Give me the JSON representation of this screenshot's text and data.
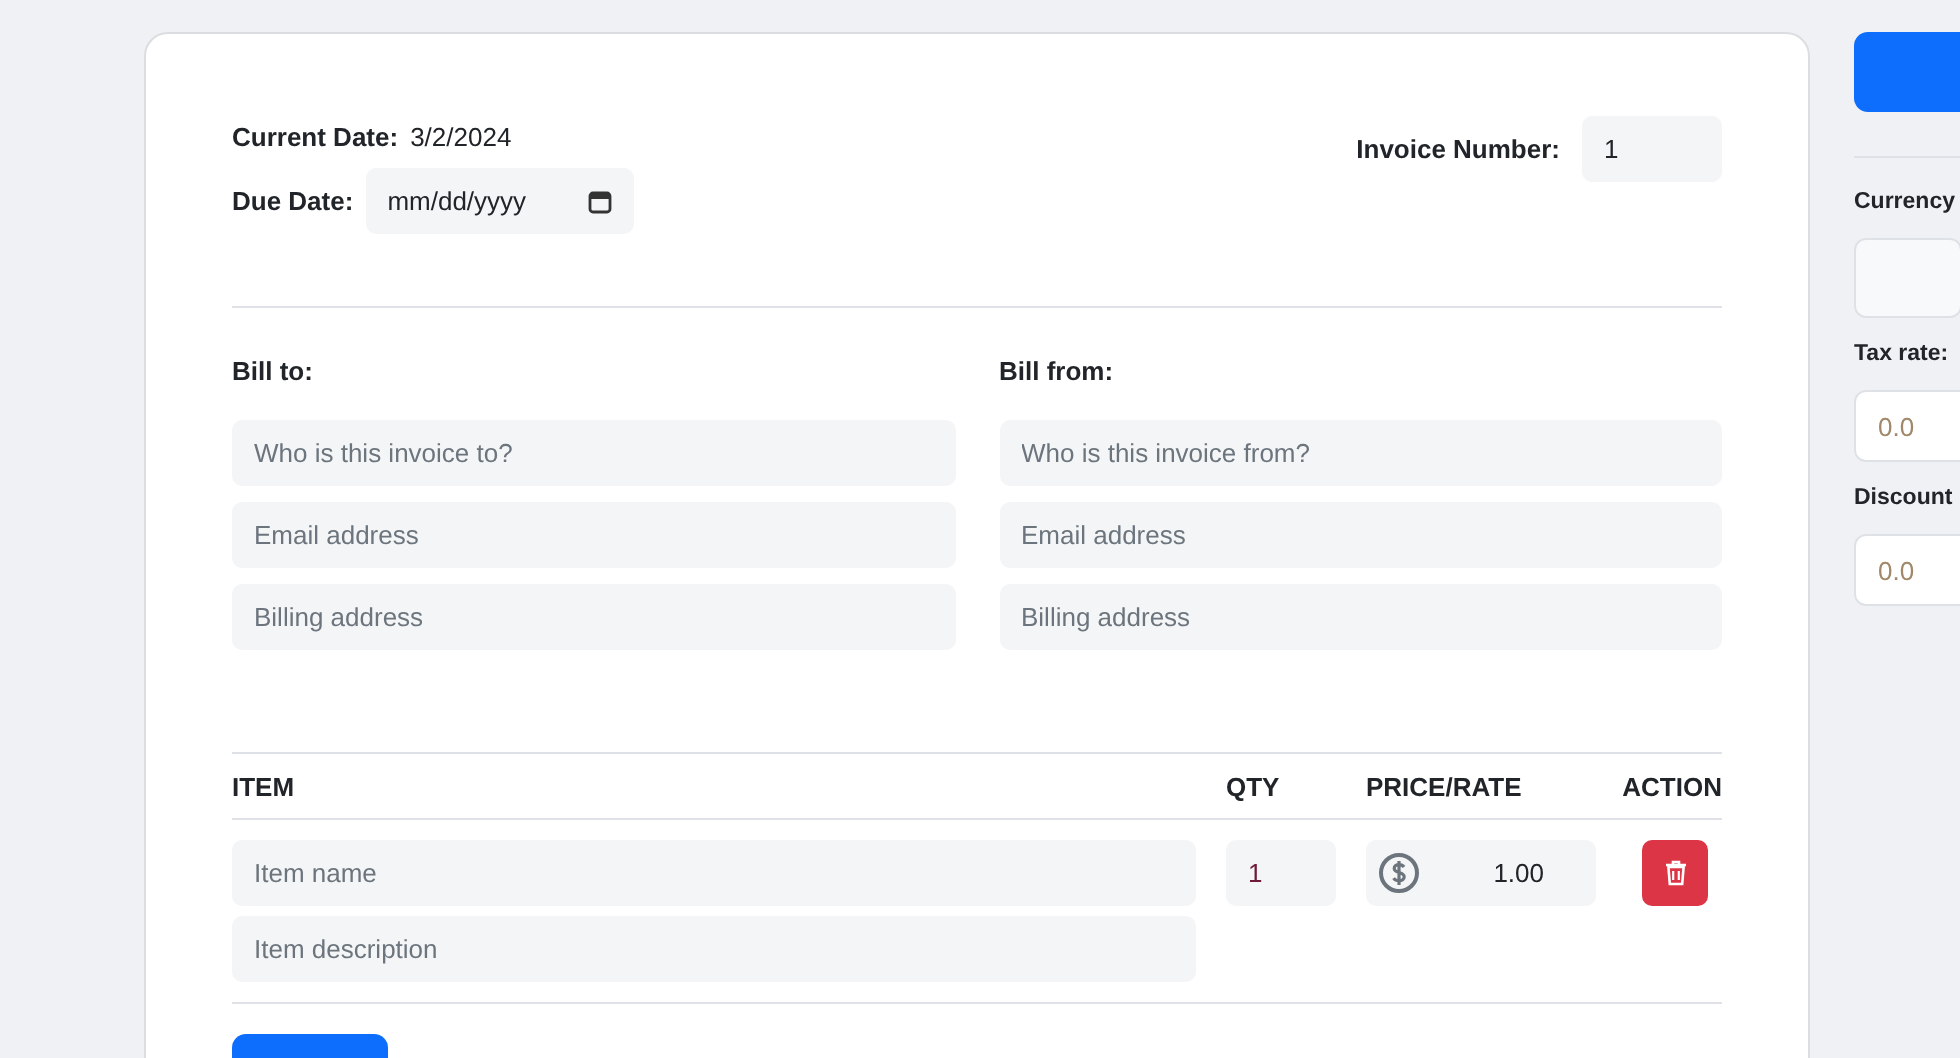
{
  "header": {
    "current_date_label": "Current Date:",
    "current_date": "3/2/2024",
    "due_date_label": "Due Date:",
    "due_date_placeholder": "mm/dd/yyyy",
    "invoice_number_label": "Invoice Number:",
    "invoice_number": "1"
  },
  "bill_to": {
    "label": "Bill to:",
    "fields": [
      {
        "placeholder": "Who is this invoice to?"
      },
      {
        "placeholder": "Email address"
      },
      {
        "placeholder": "Billing address"
      }
    ]
  },
  "bill_from": {
    "label": "Bill from:",
    "fields": [
      {
        "placeholder": "Who is this invoice from?"
      },
      {
        "placeholder": "Email address"
      },
      {
        "placeholder": "Billing address"
      }
    ]
  },
  "items_table": {
    "columns": [
      "ITEM",
      "QTY",
      "PRICE/RATE",
      "ACTION"
    ],
    "rows": [
      {
        "name_placeholder": "Item name",
        "description_placeholder": "Item description",
        "qty": "1",
        "price": "1.00"
      }
    ]
  },
  "sidebar": {
    "fields": [
      {
        "kind": "select",
        "label": "Currency"
      },
      {
        "kind": "input",
        "label": "Tax rate:",
        "placeholder": "0.0"
      },
      {
        "kind": "input",
        "label": "Discount",
        "placeholder": "0.0"
      }
    ]
  }
}
